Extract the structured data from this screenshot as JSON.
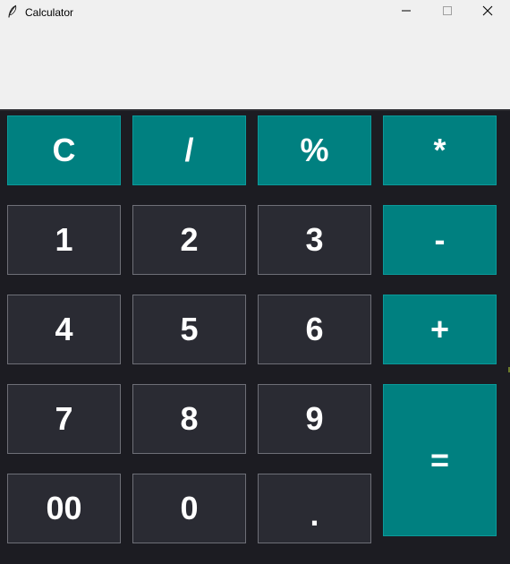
{
  "window": {
    "title": "Calculator",
    "controls": {
      "minimize": "minimize-icon",
      "maximize": "maximize-icon",
      "close": "close-icon"
    },
    "icon": "feather-icon"
  },
  "display": {
    "value": ""
  },
  "colors": {
    "operator_bg": "#008080",
    "number_bg": "#2a2b33",
    "keypad_bg": "#1c1c22",
    "display_bg": "#f0f0f0",
    "key_text": "#ffffff"
  },
  "keys": {
    "clear": "C",
    "divide": "/",
    "percent": "%",
    "multiply": "*",
    "one": "1",
    "two": "2",
    "three": "3",
    "subtract": "-",
    "four": "4",
    "five": "5",
    "six": "6",
    "add": "+",
    "seven": "7",
    "eight": "8",
    "nine": "9",
    "equals": "=",
    "double_zero": "00",
    "zero": "0",
    "decimal": "."
  }
}
